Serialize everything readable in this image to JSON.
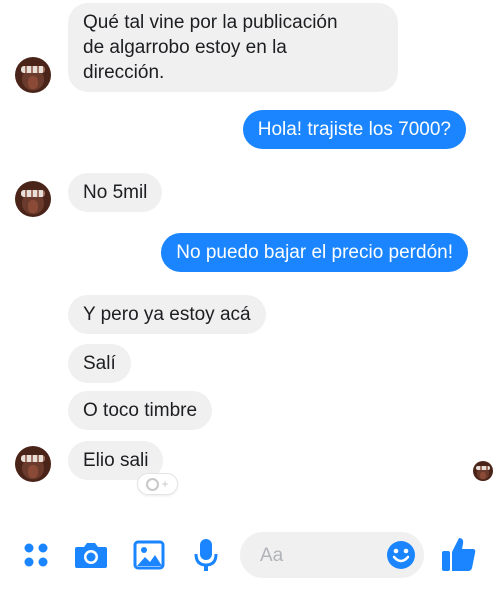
{
  "conversation": {
    "messages": [
      {
        "from": "them",
        "text": "Qué tal vine por la publicación\nde algarrobo estoy en la\ndirección."
      },
      {
        "from": "me",
        "text": "Hola! trajiste los 7000?"
      },
      {
        "from": "them",
        "text": "No 5mil"
      },
      {
        "from": "me",
        "text": "No puedo bajar el precio perdón!"
      },
      {
        "from": "them",
        "text": "Y pero ya estoy acá"
      },
      {
        "from": "them",
        "text": "Salí"
      },
      {
        "from": "them",
        "text": "O toco timbre"
      },
      {
        "from": "them",
        "text": "Elio sali"
      }
    ],
    "reaction_add_label": "+"
  },
  "composer": {
    "placeholder": "Aa",
    "icons": [
      "apps-icon",
      "camera-icon",
      "image-icon",
      "microphone-icon",
      "emoji-icon",
      "thumbs-up-icon"
    ]
  },
  "colors": {
    "accent": "#1a85ff",
    "incoming_bubble": "#f1f0f0"
  }
}
